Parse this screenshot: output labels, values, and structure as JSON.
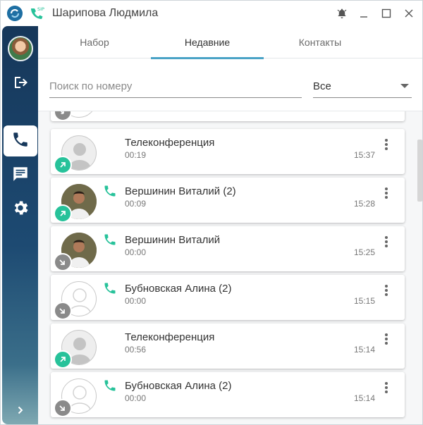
{
  "window": {
    "title": "Шарипова Людмила",
    "sip_badge": "SIP",
    "controls": [
      "bell-icon",
      "minimize-icon",
      "maximize-icon",
      "close-icon"
    ]
  },
  "sidebar": {
    "items": [
      {
        "name": "logout",
        "icon": "logout-icon"
      },
      {
        "name": "calls",
        "icon": "phone-icon",
        "active": true
      },
      {
        "name": "messages",
        "icon": "chat-icon"
      },
      {
        "name": "settings",
        "icon": "gear-icon"
      }
    ],
    "expand_icon": "chevron-right-icon"
  },
  "tabs": [
    {
      "label": "Набор"
    },
    {
      "label": "Недавние",
      "active": true
    },
    {
      "label": "Контакты"
    }
  ],
  "search": {
    "placeholder": "Поиск по номеру",
    "value": ""
  },
  "filter": {
    "value": "Все"
  },
  "colors": {
    "accent": "#4aa3c6",
    "outgoing": "#27c29a",
    "incoming": "#8a8a8a",
    "sidebar": "#16375a"
  },
  "calls": [
    {
      "name": "Телеконференция",
      "duration": "00:19",
      "time": "15:37",
      "direction": "outgoing",
      "avatar": "gray",
      "phone": false
    },
    {
      "name": "Вершинин Виталий (2)",
      "duration": "00:09",
      "time": "15:28",
      "direction": "outgoing",
      "avatar": "photo",
      "phone": true
    },
    {
      "name": "Вершинин Виталий",
      "duration": "00:00",
      "time": "15:25",
      "direction": "incoming",
      "avatar": "photo",
      "phone": true
    },
    {
      "name": "Бубновская Алина (2)",
      "duration": "00:00",
      "time": "15:15",
      "direction": "incoming",
      "avatar": "empty",
      "phone": true
    },
    {
      "name": "Телеконференция",
      "duration": "00:56",
      "time": "15:14",
      "direction": "outgoing",
      "avatar": "gray",
      "phone": false
    },
    {
      "name": "Бубновская Алина (2)",
      "duration": "00:00",
      "time": "15:14",
      "direction": "incoming",
      "avatar": "empty",
      "phone": true
    }
  ]
}
